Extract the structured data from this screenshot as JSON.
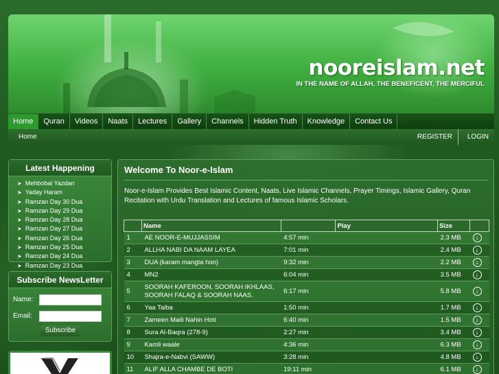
{
  "header": {
    "site_name": "nooreislam.net",
    "tagline": "IN THE NAME OF ALLAH, THE BENEFICENT, THE MERCIFUL"
  },
  "nav": {
    "items": [
      "Home",
      "Quran",
      "Videos",
      "Naats",
      "Lectures",
      "Gallery",
      "Channels",
      "Hidden Truth",
      "Knowledge",
      "Contact Us"
    ],
    "active": "Home"
  },
  "subbar": {
    "breadcrumb": "Home",
    "register": "REGISTER",
    "login": "LOGIN"
  },
  "sidebar": {
    "latest_title": "Latest Happening",
    "latest_items": [
      "Mehbobai Yazdan",
      "Yaday Haram",
      "Ramzan Day 30 Dua",
      "Ramzan Day 29 Dua",
      "Ramzan Day 28 Dua",
      "Ramzan Day 27 Dua",
      "Ramzan Day 26 Dua",
      "Ramzan Day 25 Dua",
      "Ramzan Day 24 Dua",
      "Ramzan Day 23 Dua"
    ],
    "newsletter_title": "Subscribe NewsLetter",
    "name_label": "Name:",
    "email_label": "Email:",
    "subscribe_button": "Subscribe"
  },
  "main": {
    "title": "Welcome To Noor-e-Islam",
    "intro": "Noor-e-Islam Provides Best Islamic Content, Naats, Live Islamic Channels, Prayer Timings, Islamic Gallery, Quran Recitation with Urdu Translation and Lectures of famous Islamic Scholars.",
    "table": {
      "headers": [
        "",
        "Name",
        "",
        "Play",
        "Size",
        ""
      ],
      "rows": [
        {
          "num": "1",
          "name": "AE NOOR-E-MUJJASSIM",
          "time": "4:57 min",
          "size": "2.3 MB"
        },
        {
          "num": "2",
          "name": "ALLHA NABI DA NAAM LAYEA",
          "time": "7:01 min",
          "size": "2.4 MB"
        },
        {
          "num": "3",
          "name": "DUA (karam mangta hon)",
          "time": "9:32 min",
          "size": "2.2 MB"
        },
        {
          "num": "4",
          "name": "MN2",
          "time": "6:04 min",
          "size": "3.5 MB"
        },
        {
          "num": "5",
          "name": "SOORAH KAFEROON, SOORAH IKHLAAS, SOORAH FALAQ & SOORAH NAAS.",
          "time": "6:17 min",
          "size": "5.8 MB"
        },
        {
          "num": "6",
          "name": "Yaa Taiba",
          "time": "1:50 min",
          "size": "1.7 MB"
        },
        {
          "num": "7",
          "name": "Zameen Maili Nahin Hoti",
          "time": "6:40 min",
          "size": "1.5 MB"
        },
        {
          "num": "8",
          "name": "Sura Al-Baqra (278-9)",
          "time": "2:27 min",
          "size": "3.4 MB"
        },
        {
          "num": "9",
          "name": "Kamli waale",
          "time": "4:36 min",
          "size": "6.3 MB"
        },
        {
          "num": "10",
          "name": "Shajra-e-Nabvi (SAWW)",
          "time": "3:28 min",
          "size": "4.8 MB"
        },
        {
          "num": "11",
          "name": "ALIF ALLA CHAMBE DE BOTI",
          "time": "19:11 min",
          "size": "6.1 MB"
        }
      ]
    }
  }
}
